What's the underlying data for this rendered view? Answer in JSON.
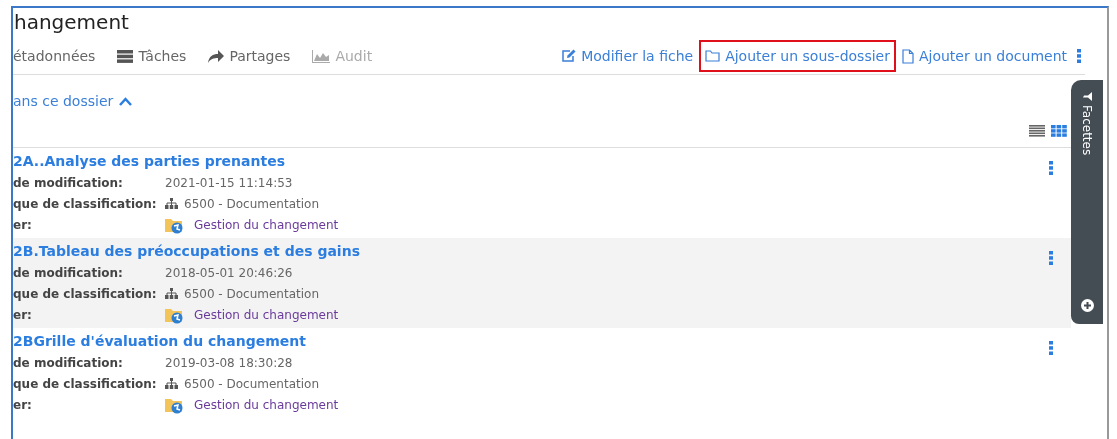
{
  "title": "hangement",
  "tabs": [
    {
      "label": "étadonnées",
      "kind": "plain",
      "disabled": false
    },
    {
      "label": "Tâches",
      "kind": "tasks",
      "disabled": false
    },
    {
      "label": "Partages",
      "kind": "share",
      "disabled": false
    },
    {
      "label": "Audit",
      "kind": "chart",
      "disabled": true
    }
  ],
  "actions": [
    {
      "label": "Modifier la fiche",
      "kind": "edit",
      "highlighted": false
    },
    {
      "label": "Ajouter un sous-dossier",
      "kind": "folder",
      "highlighted": true
    },
    {
      "label": "Ajouter un document",
      "kind": "file",
      "highlighted": false
    }
  ],
  "section": {
    "label": "ans ce dossier",
    "expanded": true
  },
  "view_modes": [
    {
      "kind": "list",
      "selected": false
    },
    {
      "kind": "grid",
      "selected": true
    }
  ],
  "facets": {
    "label": "Facettes"
  },
  "rows": [
    {
      "title": "2A..Analyse des parties prenantes",
      "selected": false,
      "fields": [
        {
          "label": "de modification:",
          "value": "2021-01-15 11:14:53",
          "kind": "text"
        },
        {
          "label": "que de classification:",
          "value": "6500 - Documentation",
          "kind": "plan"
        },
        {
          "label": "er:",
          "value": "Gestion du changement",
          "kind": "folder"
        }
      ]
    },
    {
      "title": "2B.Tableau des préoccupations et des gains",
      "selected": true,
      "fields": [
        {
          "label": "de modification:",
          "value": "2018-05-01 20:46:26",
          "kind": "text"
        },
        {
          "label": "que de classification:",
          "value": "6500 - Documentation",
          "kind": "plan"
        },
        {
          "label": "er:",
          "value": "Gestion du changement",
          "kind": "folder"
        }
      ]
    },
    {
      "title": "2BGrille d'évaluation du changement",
      "selected": false,
      "fields": [
        {
          "label": "de modification:",
          "value": "2019-03-08 18:30:28",
          "kind": "text"
        },
        {
          "label": "que de classification:",
          "value": "6500 - Documentation",
          "kind": "plan"
        },
        {
          "label": "er:",
          "value": "Gestion du changement",
          "kind": "folder"
        }
      ]
    }
  ]
}
